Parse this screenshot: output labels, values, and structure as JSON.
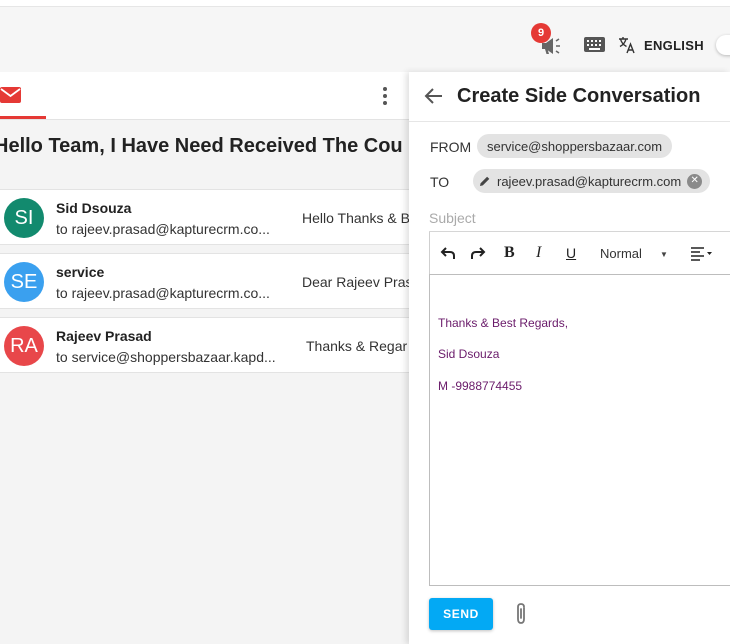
{
  "header": {
    "notification_count": "9",
    "language": "ENGLISH"
  },
  "left": {
    "subject": "Hello Team, I Have Need Received The Cou",
    "conversations": [
      {
        "initials": "SI",
        "name": "Sid Dsouza",
        "to": "to rajeev.prasad@kapturecrm.co...",
        "preview": "Hello Thanks & B",
        "color": "#128a6e"
      },
      {
        "initials": "SE",
        "name": "service",
        "to": "to rajeev.prasad@kapturecrm.co...",
        "preview": "Dear Rajeev Pras",
        "color": "#3aa0ef"
      },
      {
        "initials": "RA",
        "name": "Rajeev Prasad",
        "to": "to service@shoppersbazaar.kapd...",
        "preview": "Thanks & Regar",
        "color": "#e8474a"
      }
    ]
  },
  "side_conversation": {
    "title": "Create Side Conversation",
    "from_label": "FROM",
    "from_value": "service@shoppersbazaar.com",
    "to_label": "TO",
    "to_value": "rajeev.prasad@kapturecrm.com",
    "subject_placeholder": "Subject",
    "format_normal": "Normal",
    "body_lines": [
      "Thanks & Best Regards,",
      "Sid Dsouza",
      "M -9988774455"
    ],
    "send_label": "SEND"
  },
  "colors": {
    "accent": "#03a9f4",
    "mail_red": "#e53935",
    "signature": "#6a1b6a"
  }
}
